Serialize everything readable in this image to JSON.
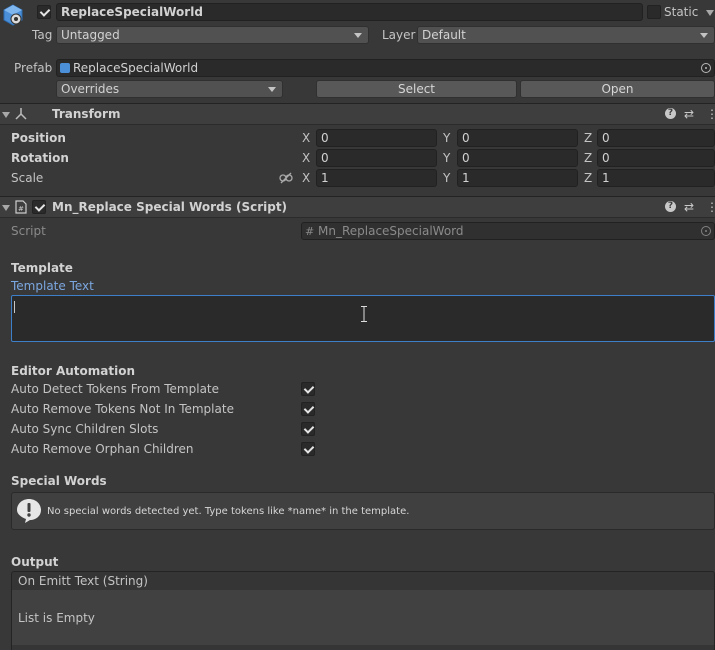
{
  "object": {
    "name": "ReplaceSpecialWorld",
    "static_label": "Static",
    "tag_label": "Tag",
    "tag_value": "Untagged",
    "layer_label": "Layer",
    "layer_value": "Default",
    "prefab_label": "Prefab",
    "prefab_value": "ReplaceSpecialWorld",
    "overrides": "Overrides",
    "select": "Select",
    "open": "Open"
  },
  "transform": {
    "title": "Transform",
    "position_label": "Position",
    "rotation_label": "Rotation",
    "scale_label": "Scale",
    "axis_x": "X",
    "axis_y": "Y",
    "axis_z": "Z",
    "position": {
      "x": "0",
      "y": "0",
      "z": "0"
    },
    "rotation": {
      "x": "0",
      "y": "0",
      "z": "0"
    },
    "scale": {
      "x": "1",
      "y": "1",
      "z": "1"
    }
  },
  "script": {
    "title": "Mn_Replace Special Words (Script)",
    "script_label": "Script",
    "script_value": "Mn_ReplaceSpecialWord",
    "template_header": "Template",
    "template_text_label": "Template Text",
    "template_text_value": "",
    "automation_header": "Editor Automation",
    "options": [
      {
        "label": "Auto Detect Tokens From Template",
        "checked": true
      },
      {
        "label": "Auto Remove Tokens Not In Template",
        "checked": true
      },
      {
        "label": "Auto Sync Children Slots",
        "checked": true
      },
      {
        "label": "Auto Remove Orphan Children",
        "checked": true
      }
    ],
    "special_header": "Special Words",
    "special_message": "No special words detected yet. Type tokens like *name* in the template.",
    "output_header": "Output",
    "event_title": "On Emitt Text (String)",
    "event_empty": "List is Empty"
  },
  "icons": {
    "help": "help-icon",
    "presets": "presets-icon",
    "menu": "kebab-menu-icon"
  }
}
